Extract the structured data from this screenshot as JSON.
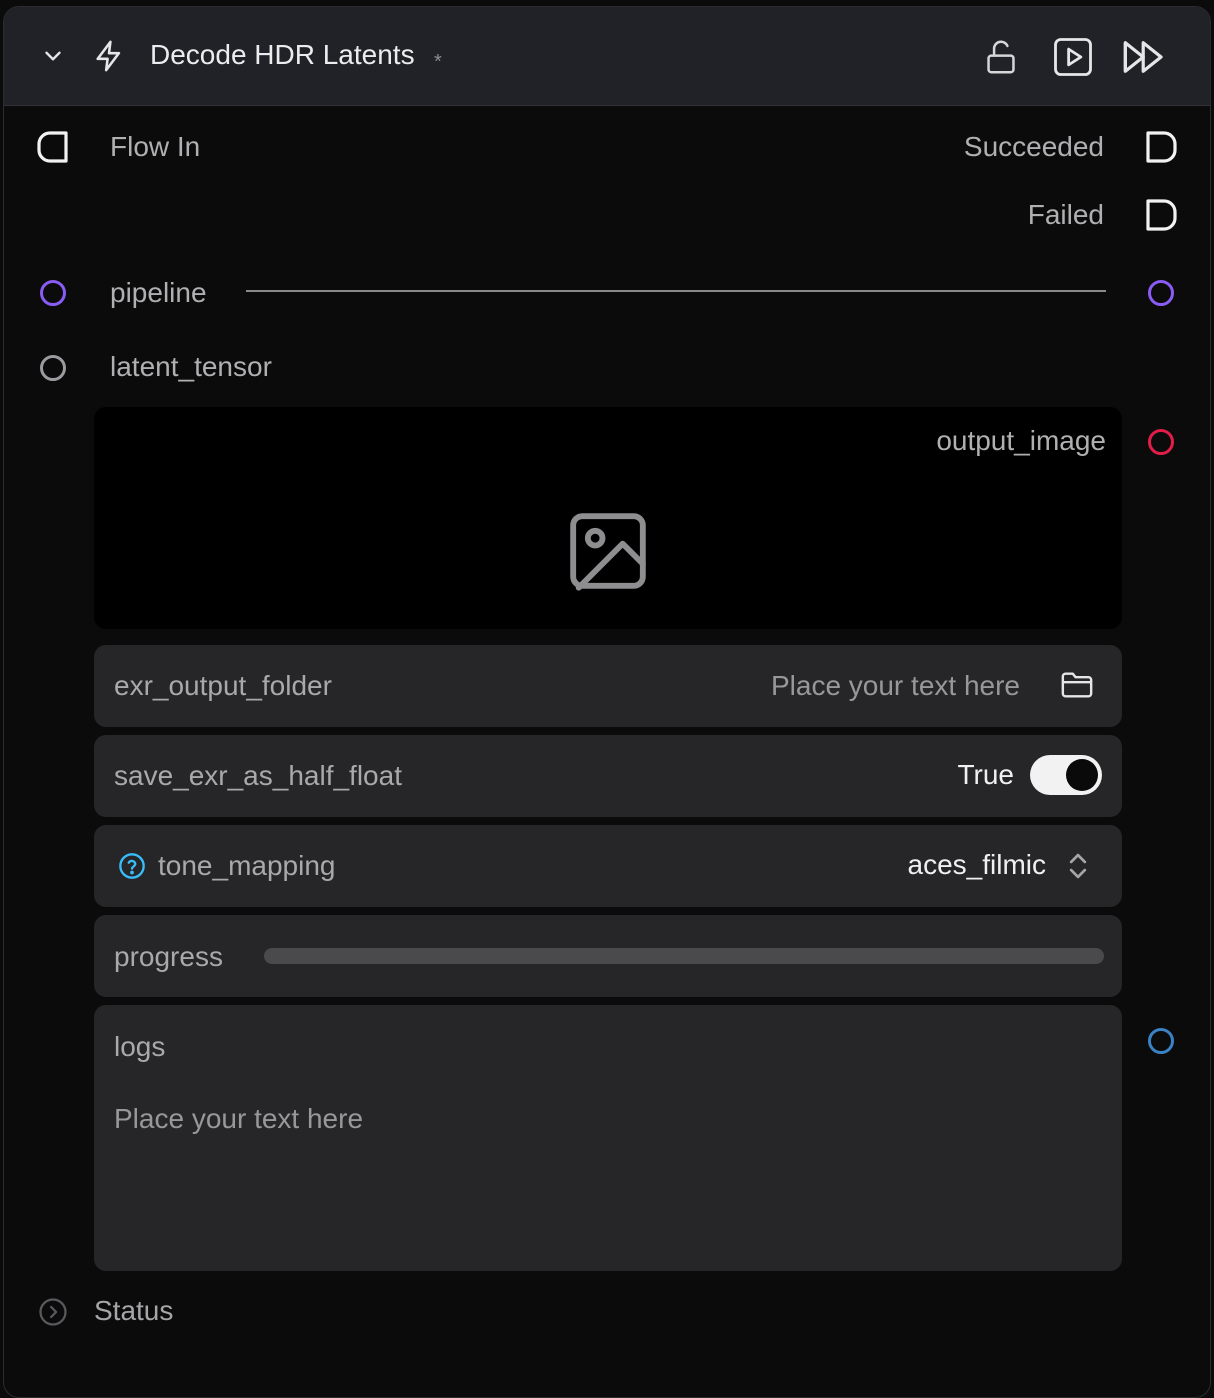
{
  "node": {
    "title": "Decode HDR Latents",
    "modified_marker": "*"
  },
  "icons": {
    "collapse": "chevron-down-icon",
    "node_type": "lightning-icon",
    "lock": "unlock-icon",
    "run": "play-icon",
    "run_all": "fast-forward-icon",
    "image_placeholder": "image-icon",
    "folder": "folder-icon",
    "help": "question-icon",
    "select": "chevron-up-down-icon",
    "status_expand": "chevron-right-icon"
  },
  "ports": {
    "flow_in": "Flow In",
    "succeeded": "Succeeded",
    "failed": "Failed",
    "pipeline": "pipeline",
    "latent_tensor": "latent_tensor",
    "output_image": "output_image"
  },
  "params": {
    "exr_output_folder": {
      "label": "exr_output_folder",
      "placeholder": "Place your text here"
    },
    "save_exr_as_half_float": {
      "label": "save_exr_as_half_float",
      "value_text": "True",
      "value": true
    },
    "tone_mapping": {
      "label": "tone_mapping",
      "value": "aces_filmic"
    },
    "progress": {
      "label": "progress",
      "value": 0
    },
    "logs": {
      "label": "logs",
      "placeholder": "Place your text here"
    }
  },
  "status": {
    "label": "Status"
  },
  "colors": {
    "pipeline_port": "#8a5cf6",
    "latent_port": "#9b9ba0",
    "image_port": "#e11d48",
    "logs_port": "#3b82c4",
    "help_icon": "#38bdf8"
  }
}
